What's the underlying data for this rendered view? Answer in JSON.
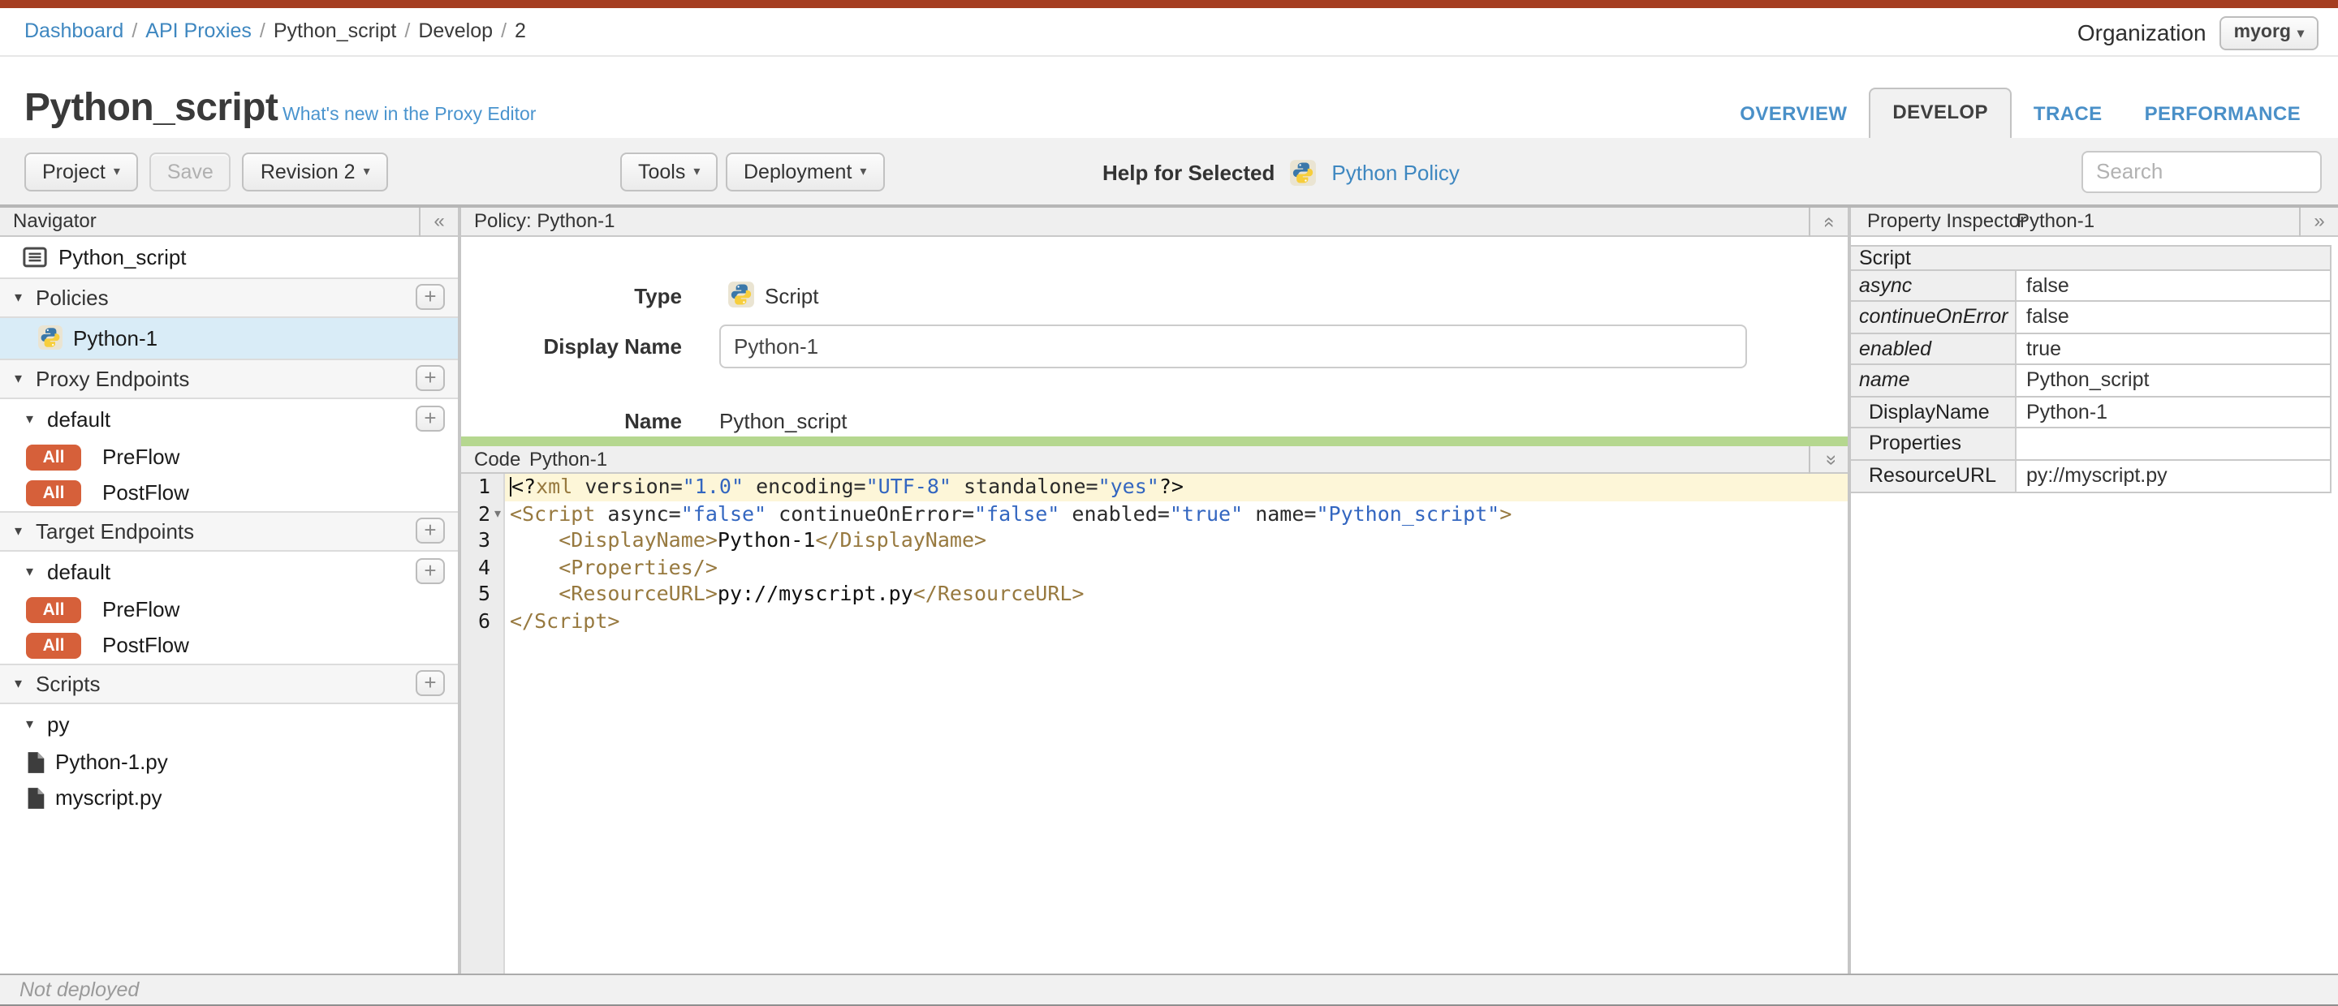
{
  "breadcrumb": {
    "separator": "/",
    "items": [
      {
        "label": "Dashboard",
        "link": true
      },
      {
        "label": "API Proxies",
        "link": true
      },
      {
        "label": "Python_script",
        "link": false
      },
      {
        "label": "Develop",
        "link": false
      },
      {
        "label": "2",
        "link": false
      }
    ]
  },
  "organization": {
    "label": "Organization",
    "value": "myorg"
  },
  "page_header": {
    "title": "Python_script",
    "whats_new_link": "What's new in the Proxy Editor"
  },
  "tabs": [
    {
      "label": "OVERVIEW",
      "active": false
    },
    {
      "label": "DEVELOP",
      "active": true
    },
    {
      "label": "TRACE",
      "active": false
    },
    {
      "label": "PERFORMANCE",
      "active": false
    }
  ],
  "toolbar": {
    "project": "Project",
    "save": "Save",
    "revision": "Revision 2",
    "tools": "Tools",
    "deployment": "Deployment",
    "help_for_selected": "Help for Selected",
    "help_link": "Python Policy",
    "search_placeholder": "Search"
  },
  "navigator": {
    "title": "Navigator",
    "items": [
      {
        "type": "proxy",
        "label": "Python_script",
        "icon": "proxy-summary"
      },
      {
        "type": "section",
        "label": "Policies",
        "plus": true
      },
      {
        "type": "policy",
        "label": "Python-1",
        "icon": "python",
        "selected": true
      },
      {
        "type": "section",
        "label": "Proxy Endpoints",
        "plus": true
      },
      {
        "type": "subsection",
        "label": "default",
        "plus": true
      },
      {
        "type": "flow",
        "label": "PreFlow",
        "badge": "All"
      },
      {
        "type": "flow",
        "label": "PostFlow",
        "badge": "All"
      },
      {
        "type": "section",
        "label": "Target Endpoints",
        "plus": true
      },
      {
        "type": "subsection",
        "label": "default",
        "plus": true
      },
      {
        "type": "flow",
        "label": "PreFlow",
        "badge": "All"
      },
      {
        "type": "flow",
        "label": "PostFlow",
        "badge": "All"
      },
      {
        "type": "section",
        "label": "Scripts",
        "plus": true
      },
      {
        "type": "subsection",
        "label": "py",
        "plus": false
      },
      {
        "type": "file",
        "label": "Python-1.py"
      },
      {
        "type": "file",
        "label": "myscript.py"
      }
    ]
  },
  "policy_panel": {
    "title": "Policy: Python-1",
    "fields": {
      "type_label": "Type",
      "type_value": "Script",
      "display_name_label": "Display Name",
      "display_name_value": "Python-1",
      "name_label": "Name",
      "name_value": "Python_script"
    }
  },
  "code_panel": {
    "title": "Code",
    "subtitle": "Python-1",
    "lines": [
      {
        "n": 1,
        "active": true,
        "tokens": [
          {
            "c": "plain",
            "s": "<?"
          },
          {
            "c": "tag",
            "s": "xml"
          },
          {
            "c": "attr",
            "s": " version="
          },
          {
            "c": "val",
            "s": "\"1.0\""
          },
          {
            "c": "attr",
            "s": " encoding="
          },
          {
            "c": "val",
            "s": "\"UTF-8\""
          },
          {
            "c": "attr",
            "s": " standalone="
          },
          {
            "c": "val",
            "s": "\"yes\""
          },
          {
            "c": "plain",
            "s": "?>"
          }
        ]
      },
      {
        "n": 2,
        "fold": true,
        "tokens": [
          {
            "c": "tag",
            "s": "<Script"
          },
          {
            "c": "attr",
            "s": " async="
          },
          {
            "c": "val",
            "s": "\"false\""
          },
          {
            "c": "attr",
            "s": " continueOnError="
          },
          {
            "c": "val",
            "s": "\"false\""
          },
          {
            "c": "attr",
            "s": " enabled="
          },
          {
            "c": "val",
            "s": "\"true\""
          },
          {
            "c": "attr",
            "s": " name="
          },
          {
            "c": "val",
            "s": "\"Python_script\""
          },
          {
            "c": "tag",
            "s": ">"
          }
        ]
      },
      {
        "n": 3,
        "tokens": [
          {
            "c": "plain",
            "s": "    "
          },
          {
            "c": "tag",
            "s": "<DisplayName>"
          },
          {
            "c": "plain",
            "s": "Python-1"
          },
          {
            "c": "tag",
            "s": "</DisplayName>"
          }
        ]
      },
      {
        "n": 4,
        "tokens": [
          {
            "c": "plain",
            "s": "    "
          },
          {
            "c": "tag",
            "s": "<Properties/>"
          }
        ]
      },
      {
        "n": 5,
        "tokens": [
          {
            "c": "plain",
            "s": "    "
          },
          {
            "c": "tag",
            "s": "<ResourceURL>"
          },
          {
            "c": "plain",
            "s": "py://myscript.py"
          },
          {
            "c": "tag",
            "s": "</ResourceURL>"
          }
        ]
      },
      {
        "n": 6,
        "tokens": [
          {
            "c": "tag",
            "s": "</Script>"
          }
        ]
      }
    ]
  },
  "property_inspector": {
    "title": "Property Inspector",
    "subtitle": "Python-1",
    "section": "Script",
    "rows": [
      {
        "label": "async",
        "value": "false",
        "attr": true
      },
      {
        "label": "continueOnError",
        "value": "false",
        "attr": true
      },
      {
        "label": "enabled",
        "value": "true",
        "attr": true
      },
      {
        "label": "name",
        "value": "Python_script",
        "attr": true
      },
      {
        "label": "DisplayName",
        "value": "Python-1",
        "attr": false
      },
      {
        "label": "Properties",
        "value": "",
        "attr": false
      },
      {
        "label": "ResourceURL",
        "value": "py://myscript.py",
        "attr": false
      }
    ]
  },
  "status_bar": {
    "text": "Not deployed"
  },
  "icons": {
    "dropdown_caret": "▾",
    "tree_caret": "▾",
    "fold_caret": "▾",
    "collapse_left": "«",
    "expand_right": "»",
    "collapse_up": "«",
    "expand_down": "«"
  },
  "colors": {
    "topbar": "#a53d20",
    "link": "#3e87c0",
    "badge": "#d6603a",
    "selected_row": "#d9ecf7",
    "active_line": "#fdf6d8",
    "green_bar": "#b5d78f",
    "tag": "#97793f",
    "value": "#3366c0"
  }
}
